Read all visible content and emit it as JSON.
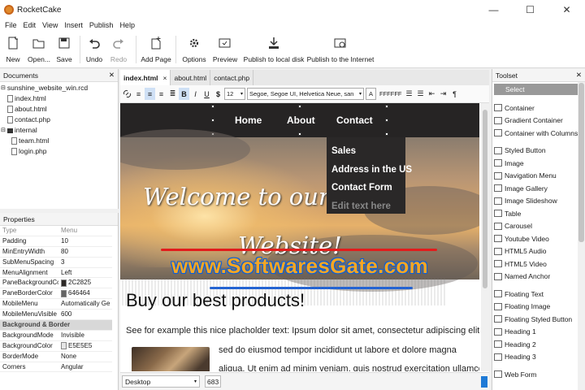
{
  "app": {
    "title": "RocketCake"
  },
  "window_buttons": {
    "minimize": "—",
    "maximize": "☐",
    "close": "✕"
  },
  "menu": [
    "File",
    "Edit",
    "View",
    "Insert",
    "Publish",
    "Help"
  ],
  "toolbar": {
    "new": "New",
    "open": "Open...",
    "save": "Save",
    "undo": "Undo",
    "redo": "Redo",
    "add_page": "Add Page",
    "options": "Options",
    "preview": "Preview",
    "publish_local": "Publish to local disk",
    "publish_internet": "Publish to the Internet"
  },
  "documents": {
    "title": "Documents",
    "close": "✕",
    "items": [
      "sunshine_website_win.rcd",
      "index.html",
      "about.html",
      "contact.php",
      "internal",
      "team.html",
      "login.php"
    ]
  },
  "properties": {
    "title": "Properties",
    "head": [
      "Type",
      "Menu"
    ],
    "rows": [
      [
        "Padding",
        "10"
      ],
      [
        "MinEntryWidth",
        "80"
      ],
      [
        "SubMenuSpacing",
        "3"
      ],
      [
        "MenuAlignment",
        "Left"
      ],
      [
        "PaneBackgroundCol",
        "2C2825"
      ],
      [
        "PaneBorderColor",
        "646464"
      ],
      [
        "MobileMenu",
        "Automatically Ge"
      ],
      [
        "MobileMenuVisible",
        "600"
      ]
    ],
    "section": "Background & Border",
    "rows2": [
      [
        "BackgroundMode",
        "Invisible"
      ],
      [
        "BackgroundColor",
        "E5E5E5"
      ],
      [
        "BorderMode",
        "None"
      ],
      [
        "Corners",
        "Angular"
      ]
    ],
    "swatch_colors": {
      "pane_bg": "#2C2825",
      "pane_border": "#646464",
      "bg": "#E5E5E5"
    }
  },
  "editor": {
    "tabs": [
      "index.html",
      "about.html",
      "contact.php"
    ],
    "tab_close": "×",
    "font_size": "12",
    "font_family": "Segoe, Segoe UI, Helvetica Neue, san",
    "text_color_label": "A",
    "color_value": "FFFFFF",
    "paragraph": "¶"
  },
  "page": {
    "nav": [
      "Home",
      "About",
      "Contact"
    ],
    "submenu": [
      "Sales",
      "Address in the US",
      "Contact Form",
      "Edit text here"
    ],
    "hero_line1": "Welcome to our",
    "hero_line2": "Website!",
    "watermark": "www.SoftwaresGate.com",
    "heading": "Buy our best products!",
    "body1": "See for example this nice placholder text: Ipsum dolor sit amet, consectetur adipiscing elit,",
    "body2": "sed do eiusmod tempor incididunt ut labore et dolore magna",
    "body3": "aliqua. Ut enim ad minim veniam, quis nostrud exercitation ullamco"
  },
  "status": {
    "view": "Desktop",
    "width": "683"
  },
  "toolset": {
    "title": "Toolset",
    "close": "✕",
    "select": "Select",
    "group1": [
      "Container",
      "Gradient Container",
      "Container with Columns"
    ],
    "group2": [
      "Styled Button",
      "Image",
      "Navigation Menu",
      "Image Gallery",
      "Image Slideshow",
      "Table",
      "Carousel",
      "Youtube Video",
      "HTML5 Audio",
      "HTML5 Video",
      "Named Anchor"
    ],
    "group3": [
      "Floating Text",
      "Floating Image",
      "Floating Styled Button",
      "Heading 1",
      "Heading 2",
      "Heading 3"
    ],
    "group4": [
      "Web Form"
    ]
  }
}
